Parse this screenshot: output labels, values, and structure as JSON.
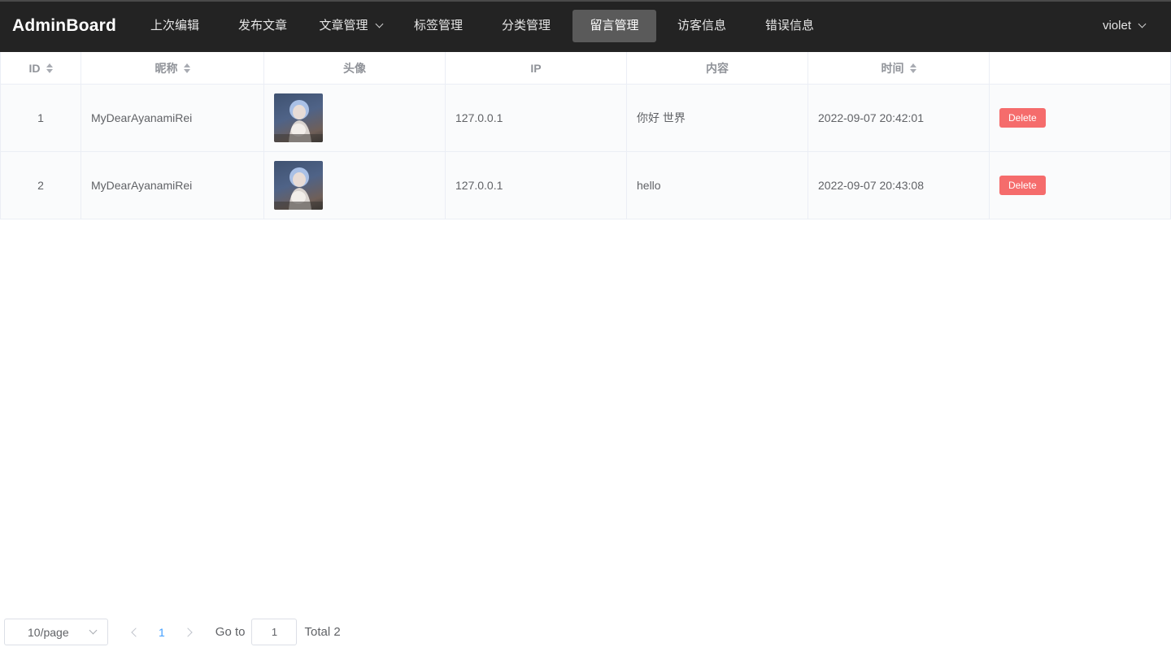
{
  "brand": "AdminBoard",
  "nav": {
    "items": [
      {
        "label": "上次编辑"
      },
      {
        "label": "发布文章"
      },
      {
        "label": "文章管理"
      },
      {
        "label": "标签管理"
      },
      {
        "label": "分类管理"
      },
      {
        "label": "留言管理",
        "active": true
      },
      {
        "label": "访客信息"
      },
      {
        "label": "错误信息"
      }
    ],
    "user": "violet"
  },
  "table": {
    "headers": {
      "id": "ID",
      "nickname": "昵称",
      "avatar": "头像",
      "ip": "IP",
      "content": "内容",
      "time": "时间",
      "actions": ""
    },
    "rows": [
      {
        "id": "1",
        "nickname": "MyDearAyanamiRei",
        "ip": "127.0.0.1",
        "content": "你好 世界",
        "time": "2022-09-07 20:42:01",
        "action": "Delete"
      },
      {
        "id": "2",
        "nickname": "MyDearAyanamiRei",
        "ip": "127.0.0.1",
        "content": "hello",
        "time": "2022-09-07 20:43:08",
        "action": "Delete"
      }
    ]
  },
  "pagination": {
    "page_size": "10/page",
    "current_page": "1",
    "goto_label": "Go to",
    "goto_value": "1",
    "total": "Total 2"
  },
  "colors": {
    "topbar": "#232323",
    "active_nav": "#5a5a5a",
    "danger": "#f56c6c",
    "link": "#409eff"
  }
}
